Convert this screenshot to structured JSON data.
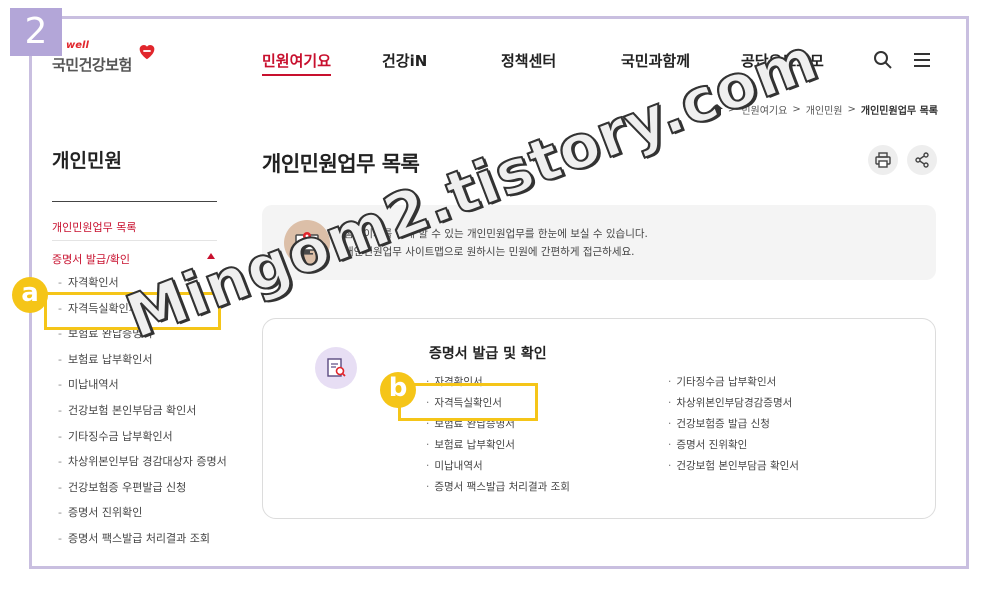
{
  "step_badge": "2",
  "logo": {
    "well": "well",
    "name": "국민건강보험",
    "heart_color": "#e1262c"
  },
  "nav": {
    "items": [
      "민원여기요",
      "건강iN",
      "정책센터",
      "국민과함께",
      "공단요모조모"
    ],
    "active_index": 0
  },
  "header_icons": [
    "search-icon",
    "menu-icon"
  ],
  "breadcrumb": {
    "home_icon": "home-icon",
    "items": [
      "민원여기요",
      "개인민원",
      "개인민원업무 목록"
    ]
  },
  "sidebar": {
    "title": "개인민원",
    "link_main": "개인민원업무 목록",
    "group": "증명서 발급/확인",
    "items": [
      "자격확인서",
      "자격득실확인서",
      "보험료 완납증명서",
      "보험료 납부확인서",
      "미납내역서",
      "건강보험 본인부담금 확인서",
      "기타징수금 납부확인서",
      "차상위본인부담 경감대상자 증명서",
      "건강보험증 우편발급 신청",
      "증명서 진위확인",
      "증명서 팩스발급 처리결과 조회"
    ]
  },
  "main": {
    "title": "개인민원업무 목록",
    "actions": [
      "print-icon",
      "share-icon"
    ],
    "info_lines": [
      "홈페이지를 통해 할 수 있는 개인민원업무를 한눈에 보실 수 있습니다.",
      "개인민원업무 사이트맵으로 원하시는 민원에 간편하게 접근하세요."
    ],
    "card": {
      "title": "증명서 발급 및 확인",
      "col1": [
        "자격확인서",
        "자격득실확인서",
        "보험료 완납증명서",
        "보험료 납부확인서",
        "미납내역서",
        "증명서 팩스발급 처리결과 조회"
      ],
      "col2": [
        "기타징수금 납부확인서",
        "차상위본인부담경감증명서",
        "건강보험증 발급 신청",
        "증명서 진위확인",
        "건강보험 본인부담금 확인서"
      ]
    }
  },
  "annotations": {
    "a": "a",
    "b": "b",
    "color": "#f5c518"
  },
  "watermark": "Mingom2.tistory.com",
  "colors": {
    "accent": "#c8102e",
    "frame": "#c9bfe0",
    "badge": "#b3a6d8"
  }
}
